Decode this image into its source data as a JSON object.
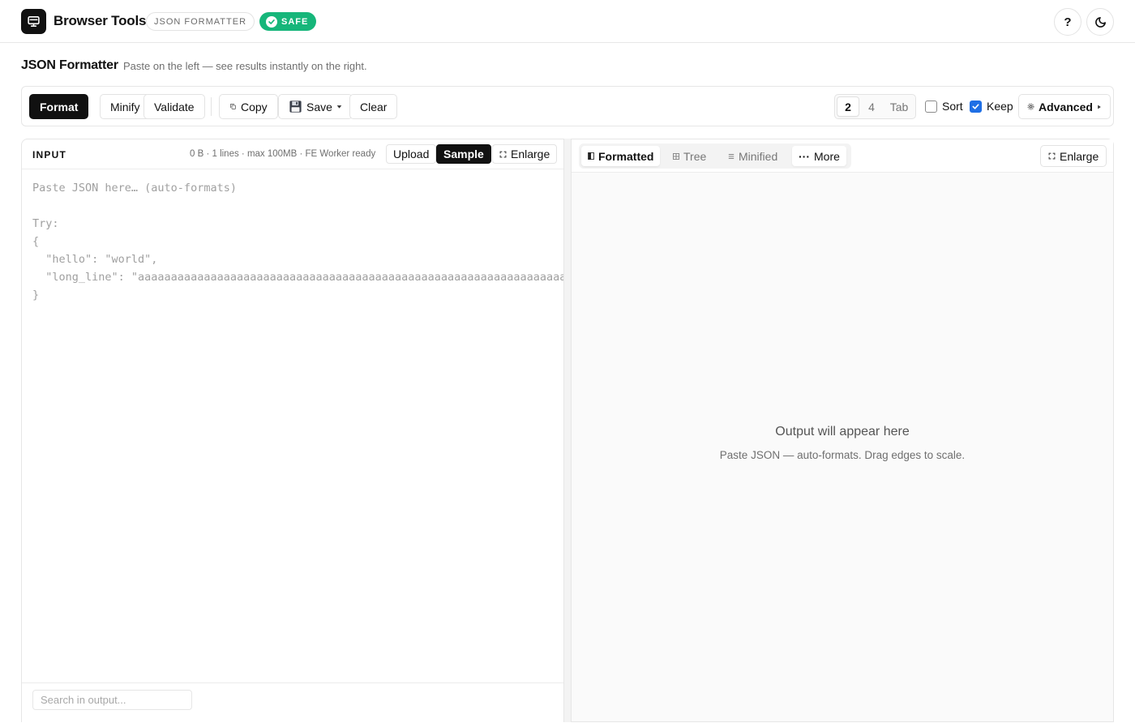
{
  "header": {
    "brand": "Browser Tools",
    "tool_tag": "JSON FORMATTER",
    "safe_badge": "SAFE",
    "help_label": "?",
    "icons": {
      "logo": "monitor-icon",
      "theme": "moon-icon",
      "safe": "check-circle-icon"
    }
  },
  "page": {
    "title": "JSON Formatter",
    "subtitle": "Paste on the left — see results instantly on the right."
  },
  "toolbar": {
    "format": "Format",
    "minify": "Minify",
    "validate": "Validate",
    "copy": "Copy",
    "save": "Save",
    "clear": "Clear",
    "indent_options": [
      "2",
      "4",
      "Tab"
    ],
    "indent_selected": "2",
    "sort_label": "Sort",
    "sort_checked": false,
    "keep_label": "Keep",
    "keep_checked": true,
    "advanced": "Advanced"
  },
  "input": {
    "label": "INPUT",
    "meta": "0 B · 1 lines · max 100MB · FE Worker ready",
    "upload": "Upload",
    "sample": "Sample",
    "enlarge": "Enlarge",
    "placeholder": "Paste JSON here… (auto-formats)\n\nTry:\n{\n  \"hello\": \"world\",\n  \"long_line\": \"aaaaaaaaaaaaaaaaaaaaaaaaaaaaaaaaaaaaaaaaaaaaaaaaaaaaaaaaaaaaaaaaaa\n}",
    "search_placeholder": "Search in output..."
  },
  "output": {
    "tabs": [
      "Formatted",
      "Tree",
      "Minified"
    ],
    "active_tab": "Formatted",
    "more": "More",
    "enlarge": "Enlarge",
    "empty_title": "Output will appear here",
    "empty_subtitle": "Paste JSON — auto-formats. Drag edges to scale."
  },
  "colors": {
    "accent": "#111111",
    "safe": "#16b67a",
    "checkbox": "#1f6fe5"
  }
}
